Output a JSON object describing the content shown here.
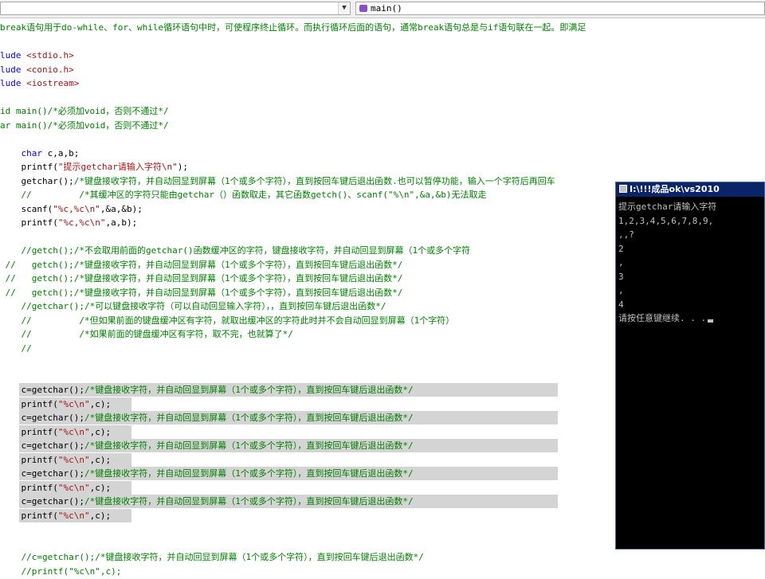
{
  "toolbar": {
    "function_label": "main()"
  },
  "editor": {
    "lines": [
      {
        "text": "break语句用于do-while、for、while循环语句中时，可使程序终止循环。而执行循环后面的语句，通常break语句总是与if语句联在一起。即满足",
        "kind": "comment"
      },
      {
        "text": "",
        "kind": "code"
      },
      {
        "text": "lude <stdio.h>",
        "kind": "include"
      },
      {
        "text": "lude <conio.h>",
        "kind": "include"
      },
      {
        "text": "lude <iostream>",
        "kind": "include"
      },
      {
        "text": "",
        "kind": "code"
      },
      {
        "text": "id main()/*必须加void，否则不通过*/",
        "kind": "comment"
      },
      {
        "text": "ar main()/*必须加void，否则不通过*/",
        "kind": "comment"
      },
      {
        "text": "",
        "kind": "code"
      },
      {
        "text": "    char c,a,b;",
        "kind": "code"
      },
      {
        "text": "    printf(\"提示getchar请输入字符\\n\");",
        "kind": "code"
      },
      {
        "text": "    getchar();/*键盘接收字符，并自动回显到屏幕（1个或多个字符），直到按回车键后退出函数.也可以暂停功能，输入一个字符后再回车",
        "kind": "code"
      },
      {
        "text": "    //         /*其缓冲区的字符只能由getchar（）函数取走，其它函数getch()、scanf(\"%\\n\",&a,&b)无法取走",
        "kind": "comment"
      },
      {
        "text": "    scanf(\"%c,%c\\n\",&a,&b);",
        "kind": "code"
      },
      {
        "text": "    printf(\"%c,%c\\n\",a,b);",
        "kind": "code"
      },
      {
        "text": "",
        "kind": "code"
      },
      {
        "text": "    //getch();/*不会取用前面的getchar()函数缓冲区的字符，键盘接收字符，并自动回显到屏幕（1个或多个字符",
        "kind": "comment"
      },
      {
        "text": " //   getch();/*键盘接收字符，并自动回显到屏幕（1个或多个字符），直到按回车键后退出函数*/",
        "kind": "comment"
      },
      {
        "text": " //   getch();/*键盘接收字符，并自动回显到屏幕（1个或多个字符），直到按回车键后退出函数*/",
        "kind": "comment"
      },
      {
        "text": " //   getch();/*键盘接收字符，并自动回显到屏幕（1个或多个字符），直到按回车键后退出函数*/",
        "kind": "comment"
      },
      {
        "text": "    //getchar();/*可以键盘接收字符（可以自动回显输入字符），，直到按回车键后退出函数*/",
        "kind": "comment"
      },
      {
        "text": "    //         /*但如果前面的键盘缓冲区有字符，就取出缓冲区的字符此时并不会自动回显到屏幕（1个字符）",
        "kind": "comment"
      },
      {
        "text": "    //         /*如果前面的键盘缓冲区有字符，取不完，也就算了*/",
        "kind": "comment"
      },
      {
        "text": "    //",
        "kind": "comment"
      },
      {
        "text": "",
        "kind": "code"
      },
      {
        "text": "",
        "kind": "code"
      },
      {
        "text": "    c=getchar();/*键盘接收字符，并自动回显到屏幕（1个或多个字符），直到按回车键后退出函数*/",
        "kind": "code"
      },
      {
        "text": "    printf(\"%c\\n\",c);",
        "kind": "code"
      },
      {
        "text": "    c=getchar();/*键盘接收字符，并自动回显到屏幕（1个或多个字符），直到按回车键后退出函数*/",
        "kind": "code"
      },
      {
        "text": "    printf(\"%c\\n\",c);",
        "kind": "code"
      },
      {
        "text": "    c=getchar();/*键盘接收字符，并自动回显到屏幕（1个或多个字符），直到按回车键后退出函数*/",
        "kind": "code"
      },
      {
        "text": "    printf(\"%c\\n\",c);",
        "kind": "code"
      },
      {
        "text": "    c=getchar();/*键盘接收字符，并自动回显到屏幕（1个或多个字符），直到按回车键后退出函数*/",
        "kind": "code"
      },
      {
        "text": "    printf(\"%c\\n\",c);",
        "kind": "code"
      },
      {
        "text": "    c=getchar();/*键盘接收字符，并自动回显到屏幕（1个或多个字符），直到按回车键后退出函数*/",
        "kind": "code"
      },
      {
        "text": "    printf(\"%c\\n\",c);",
        "kind": "code"
      },
      {
        "text": "",
        "kind": "code"
      },
      {
        "text": "",
        "kind": "code"
      },
      {
        "text": "    //c=getchar();/*键盘接收字符，并自动回显到屏幕（1个或多个字符），直到按回车键后退出函数*/",
        "kind": "comment"
      },
      {
        "text": "    //printf(\"%c\\n\",c);",
        "kind": "comment"
      }
    ]
  },
  "console": {
    "title": "I:\\!!!成品ok\\vs2010",
    "lines": [
      "提示getchar请输入字符",
      "1,2,3,4,5,6,7,8,9,",
      ",,?",
      "2",
      ",",
      "3",
      ",",
      "4",
      "请按任意键继续. . ."
    ]
  },
  "colors": {
    "keyword": "#0000ff",
    "comment": "#008000",
    "string": "#a31515",
    "selection": "#d4d4d4",
    "console_bg": "#000000",
    "console_fg": "#c0c0c0",
    "title_bar": "#0a246a"
  }
}
